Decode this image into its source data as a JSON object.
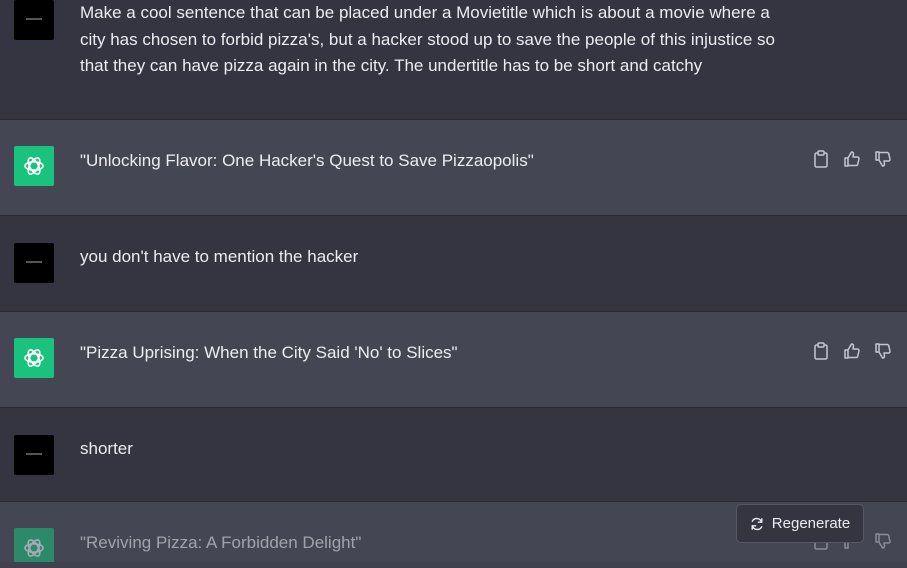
{
  "messages": [
    {
      "role": "user",
      "text": "Make a cool sentence that can be placed under a Movietitle which is about a movie where a city has chosen to forbid pizza's, but a hacker stood up to save the people of this injustice so that they can have pizza again in the city. The undertitle has to be short and catchy"
    },
    {
      "role": "assistant",
      "text": "\"Unlocking Flavor: One Hacker's Quest to Save Pizzaopolis\""
    },
    {
      "role": "user",
      "text": "you don't have to mention the hacker"
    },
    {
      "role": "assistant",
      "text": "\"Pizza Uprising: When the City Said 'No' to Slices\""
    },
    {
      "role": "user",
      "text": "shorter"
    },
    {
      "role": "assistant",
      "text": "\"Reviving Pizza: A Forbidden Delight\""
    }
  ],
  "regenerate_label": "Regenerate",
  "icons": {
    "copy": "clipboard-icon",
    "like": "thumbs-up-icon",
    "dislike": "thumbs-down-icon",
    "regenerate": "refresh-icon",
    "assistant_avatar": "openai-logo-icon"
  },
  "colors": {
    "user_bg": "#343541",
    "assistant_bg": "#444654",
    "accent": "#19c37d",
    "text": "#ececf1",
    "icon": "#c5c5d2"
  }
}
